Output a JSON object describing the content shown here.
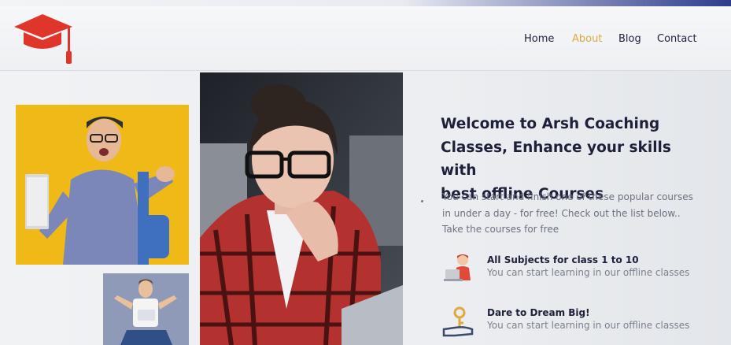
{
  "nav": {
    "items": [
      {
        "label": "Home",
        "active": false
      },
      {
        "label": "About",
        "active": true
      },
      {
        "label": "Blog",
        "active": false
      },
      {
        "label": "Contact",
        "active": false
      }
    ]
  },
  "logo": {
    "icon": "graduation-cap-icon",
    "color": "#e0352b"
  },
  "hero": {
    "title_lines": [
      "Welcome to Arsh Coaching",
      "Classes, Enhance your skills with",
      "best offline Courses"
    ],
    "description_lines": [
      "You can start and finish one of these popular courses",
      "in under a day - for free! Check out the list below..",
      "Take the courses for free"
    ]
  },
  "features": [
    {
      "icon": "student-laptop-icon",
      "title": "All Subjects for class 1 to 10",
      "text": "You can start learning in our offline classes"
    },
    {
      "icon": "hand-key-icon",
      "title": "Dare to Dream Big!",
      "text": "You can start learning in our offline classes"
    }
  ],
  "colors": {
    "accent": "#e0a83e",
    "brand": "#e0352b",
    "heading": "#1d2038"
  }
}
